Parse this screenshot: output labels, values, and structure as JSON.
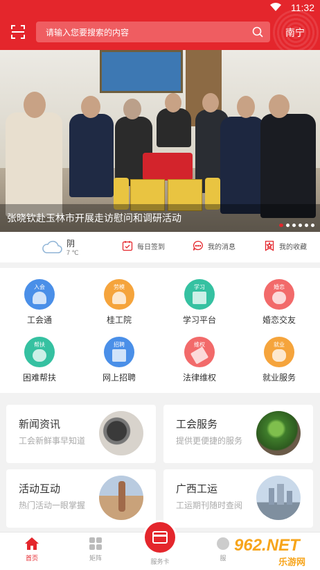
{
  "status": {
    "time": "11:32"
  },
  "header": {
    "search_placeholder": "请输入您要搜索的内容",
    "city": "南宁"
  },
  "banner": {
    "caption": "张晓钦赴玉林市开展走访慰问和调研活动",
    "slide_count": 6,
    "active_slide": 1
  },
  "quickbar": {
    "weather": {
      "condition": "阴",
      "temperature": "7 ℃"
    },
    "checkin": "每日签到",
    "messages": "我的消息",
    "favorites": "我的收藏"
  },
  "services": [
    {
      "label": "工会通",
      "badge": "入会",
      "color": "#4a8fe8"
    },
    {
      "label": "桂工院",
      "badge": "劳模",
      "color": "#f5a43c"
    },
    {
      "label": "学习平台",
      "badge": "学习",
      "color": "#35c1a1"
    },
    {
      "label": "婚恋交友",
      "badge": "婚恋",
      "color": "#f26a6a"
    },
    {
      "label": "困难帮扶",
      "badge": "帮扶",
      "color": "#35c1a1"
    },
    {
      "label": "网上招聘",
      "badge": "招聘",
      "color": "#4a8fe8"
    },
    {
      "label": "法律维权",
      "badge": "维权",
      "color": "#f26a6a"
    },
    {
      "label": "就业服务",
      "badge": "就业",
      "color": "#f5a43c"
    }
  ],
  "cards": [
    {
      "title": "新闻资讯",
      "subtitle": "工会新鲜事早知道"
    },
    {
      "title": "工会服务",
      "subtitle": "提供更便捷的服务"
    },
    {
      "title": "活动互动",
      "subtitle": "热门活动一眼掌握"
    },
    {
      "title": "广西工运",
      "subtitle": "工运期刊随时查阅"
    }
  ],
  "tabs": [
    {
      "label": "首页"
    },
    {
      "label": "矩阵"
    },
    {
      "label": "服务卡"
    },
    {
      "label": "服"
    }
  ],
  "watermark": {
    "brand": "962.NET",
    "sub": "乐游网"
  },
  "colors": {
    "primary": "#e4262c"
  }
}
